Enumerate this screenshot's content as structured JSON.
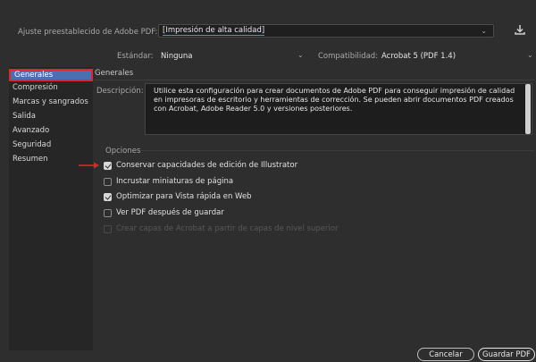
{
  "preset": {
    "label": "Ajuste preestablecido de Adobe PDF:",
    "value": "[Impresión de alta calidad]"
  },
  "standard": {
    "label": "Estándar:",
    "value": "Ninguna"
  },
  "compatibility": {
    "label": "Compatibilidad:",
    "value": "Acrobat 5 (PDF 1.4)"
  },
  "sidebar": {
    "items": [
      {
        "label": "Generales"
      },
      {
        "label": "Compresión"
      },
      {
        "label": "Marcas y sangrados"
      },
      {
        "label": "Salida"
      },
      {
        "label": "Avanzado"
      },
      {
        "label": "Seguridad"
      },
      {
        "label": "Resumen"
      }
    ]
  },
  "main": {
    "title": "Generales",
    "description_label": "Descripción:",
    "description": "Utilice esta configuración para crear documentos de Adobe PDF para conseguir impresión de calidad en impresoras de escritorio y herramientas de corrección. Se pueden abrir documentos PDF creados con Acrobat, Adobe Reader 5.0 y versiones posteriores.",
    "options_title": "Opciones",
    "options": [
      {
        "label": "Conservar capacidades de edición de Illustrator",
        "checked": true,
        "disabled": false
      },
      {
        "label": "Incrustar miniaturas de página",
        "checked": false,
        "disabled": false
      },
      {
        "label": "Optimizar para Vista rápida en Web",
        "checked": true,
        "disabled": false
      },
      {
        "label": "Ver PDF después de guardar",
        "checked": false,
        "disabled": false
      },
      {
        "label": "Crear capas de Acrobat a partir de capas de nivel superior",
        "checked": false,
        "disabled": true
      }
    ]
  },
  "buttons": {
    "cancel": "Cancelar",
    "save": "Guardar PDF"
  },
  "colors": {
    "accent": "#4b6fb0",
    "highlight": "#e0262c",
    "background": "#2e2e2e"
  }
}
